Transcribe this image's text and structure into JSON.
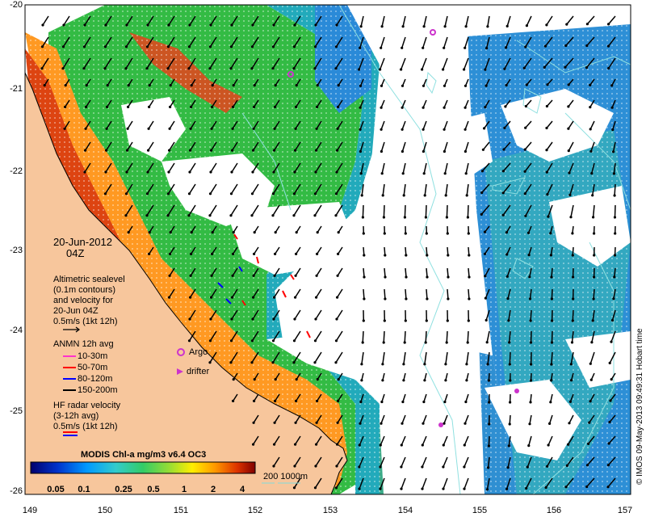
{
  "map": {
    "date": "20-Jun-2012",
    "time": "04Z",
    "y_ticks": [
      "-20",
      "-21",
      "-22",
      "-23",
      "-24",
      "-25",
      "-26"
    ],
    "x_ticks": [
      "149",
      "150",
      "151",
      "152",
      "153",
      "154",
      "155",
      "156",
      "157"
    ],
    "colors": {
      "land": "#f7c69c",
      "contour": "#7fdcdc",
      "argo": "#cc33cc",
      "drifter": "#cc33cc"
    }
  },
  "altimetry_legend": {
    "lines": [
      "Altimetric sealevel",
      "(0.1m contours)",
      "and velocity for",
      "20-Jun 04Z",
      "0.5m/s (1kt 12h)"
    ]
  },
  "anmn_legend": {
    "title": "ANMN 12h avg",
    "items": [
      {
        "label": "10-30m",
        "color": "#ff33cc"
      },
      {
        "label": "50-70m",
        "color": "#ff0000"
      },
      {
        "label": "80-120m",
        "color": "#0000ff"
      },
      {
        "label": "150-200m",
        "color": "#000000"
      }
    ]
  },
  "markers": {
    "argo": "Argo",
    "drifter": "drifter"
  },
  "hf_legend": {
    "lines": [
      "HF radar velocity",
      "(3-12h avg)",
      "0.5m/s (1kt 12h)"
    ]
  },
  "colorbar": {
    "title": "MODIS Chl-a mg/m3 v6.4 OC3",
    "ticks": [
      "0.05",
      "0.1",
      "0.25",
      "0.5",
      "1",
      "2",
      "4"
    ]
  },
  "depth_legend": "200  1000m",
  "credit": "© IMOS 09-May-2013 09:49:31 Hobart time"
}
